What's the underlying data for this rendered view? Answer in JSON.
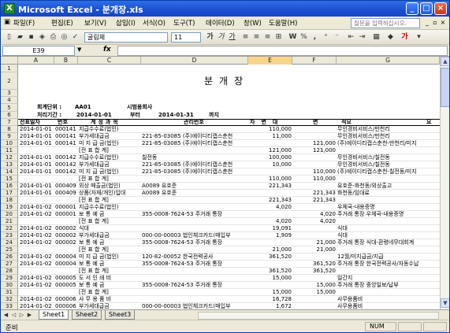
{
  "window": {
    "title": "Microsoft Excel - 분개장.xls",
    "min": "_",
    "max": "□",
    "close": "×"
  },
  "menu": {
    "items": [
      "파일(F)",
      "편집(E)",
      "보기(V)",
      "삽입(I)",
      "서식(O)",
      "도구(T)",
      "데이터(D)",
      "창(W)",
      "도움말(H)"
    ],
    "ask_placeholder": "질문을 입력하십시오."
  },
  "toolbar": {
    "font_name": "굴림체",
    "font_size": "11",
    "bold": "가",
    "italic": "가",
    "underline": "가",
    "percent": "%",
    "comma": ",",
    "won": "W",
    "font_color_letter": "가"
  },
  "formula": {
    "cell_ref": "E39",
    "fx": "fx",
    "value": ""
  },
  "columns": [
    "A",
    "B",
    "C",
    "D",
    "E",
    "F",
    "G"
  ],
  "header_rows": {
    "r1": "1",
    "r2": "2",
    "r3": "3",
    "r4": "4",
    "r5": "5",
    "r6": "6",
    "r7": "7",
    "title": "분개장",
    "unit_label": "회계단위 :",
    "unit_code": "AA01",
    "unit_name": "시범용회사",
    "period_label": "처리기간 :",
    "period_from": "2014-01-01",
    "period_to_label": "부터",
    "period_to": "2014-01-31",
    "period_end_label": "까지"
  },
  "table_header": {
    "date": "전표일자",
    "no": "번호",
    "account": "계정과목",
    "mgmt": "관리번호",
    "debit": "차변대",
    "credit": "변",
    "memo": "적요",
    "memo_end": "요"
  },
  "rows": [
    {
      "n": "8",
      "a": "2014-01-01",
      "b": "000141",
      "c": "지급수수료(법인)",
      "d": "",
      "e": "110,000",
      "f": "",
      "g": "무인경비서비스/만천리"
    },
    {
      "n": "9",
      "a": "2014-01-01",
      "b": "000141",
      "c": "부가세대급금",
      "d": "221-85-03085  (주)에이디티캡스춘천",
      "e": "11,000",
      "f": "",
      "g": "무인경비서비스/만천리"
    },
    {
      "n": "10",
      "a": "2014-01-01",
      "b": "000141",
      "c": "미 지 급 금(법인)",
      "d": "221-85-03085  (주)에이디티캡스춘천",
      "e": "",
      "f": "121,000",
      "g": "(주)에이디티캡스춘천-만천리/미지"
    },
    {
      "n": "11",
      "a": "",
      "b": "",
      "c": "[전 표 합 계]",
      "d": "",
      "e": "121,000",
      "f": "121,000",
      "g": ""
    },
    {
      "n": "12",
      "a": "2014-01-01",
      "b": "000142",
      "c": "지급수수료(법인)",
      "d": "칠전동",
      "e": "100,000",
      "f": "",
      "g": "무인경비서비스/칠전동"
    },
    {
      "n": "13",
      "a": "2014-01-01",
      "b": "000142",
      "c": "부가세대급금",
      "d": "221-85-03085  (주)에이디티캡스춘천",
      "e": "10,000",
      "f": "",
      "g": "무인경비서비스/칠전동"
    },
    {
      "n": "14",
      "a": "2014-01-01",
      "b": "000142",
      "c": "미 지 급 금(법인)",
      "d": "221-85-03085  (주)에이디티캡스춘천",
      "e": "",
      "f": "110,000",
      "g": "(주)에이디티캡스춘천-칠전동/미지"
    },
    {
      "n": "15",
      "a": "",
      "b": "",
      "c": "[전 표 합 계]",
      "d": "",
      "e": "110,000",
      "f": "110,000",
      "g": ""
    },
    {
      "n": "16",
      "a": "2014-01-01",
      "b": "000409",
      "c": "외상 매출금(법인)",
      "d": "A0089  유호준",
      "e": "221,343",
      "f": "",
      "g": "유호준-화천동/외상출고"
    },
    {
      "n": "17",
      "a": "2014-01-01",
      "b": "000409",
      "c": "상품(자재/개인)입대",
      "d": "A0089  유호준",
      "e": "",
      "f": "221,343",
      "g": "화천동/임대료"
    },
    {
      "n": "18",
      "a": "",
      "b": "",
      "c": "[전 표 합 계]",
      "d": "",
      "e": "221,343",
      "f": "221,343",
      "g": ""
    },
    {
      "n": "19",
      "a": "2014-01-02",
      "b": "000001",
      "c": "지급수수료(법인)",
      "d": "",
      "e": "4,020",
      "f": "",
      "g": "우체국-내용증명"
    },
    {
      "n": "20",
      "a": "2014-01-02",
      "b": "000001",
      "c": "보    통    예    금",
      "d": "355-0008-7624-53  주거래 통장",
      "e": "",
      "f": "4,020",
      "g": "주거래 통장 우체국-내용증명"
    },
    {
      "n": "21",
      "a": "",
      "b": "",
      "c": "[전 표 합 계]",
      "d": "",
      "e": "4,020",
      "f": "4,020",
      "g": ""
    },
    {
      "n": "22",
      "a": "2014-01-02",
      "b": "000002",
      "c": "식대",
      "d": "",
      "e": "19,091",
      "f": "",
      "g": "식대"
    },
    {
      "n": "23",
      "a": "2014-01-02",
      "b": "000002",
      "c": "부가세대급금",
      "d": "000-00-00003  법인체크카드(매입부",
      "e": "1,909",
      "f": "",
      "g": "식대"
    },
    {
      "n": "24",
      "a": "2014-01-02",
      "b": "000002",
      "c": "보    통    예    금",
      "d": "355-0008-7624-53  주거래 통장",
      "e": "",
      "f": "21,000",
      "g": "주거래 통장 식대-환령네무대회계"
    },
    {
      "n": "25",
      "a": "",
      "b": "",
      "c": "[전 표 합 계]",
      "d": "",
      "e": "21,000",
      "f": "21,000",
      "g": ""
    },
    {
      "n": "26",
      "a": "2014-01-02",
      "b": "000004",
      "c": "미 지 급 금(법인)",
      "d": "120-82-00052  한국전력공사",
      "e": "361,520",
      "f": "",
      "g": "12월/미지급금/지급"
    },
    {
      "n": "27",
      "a": "2014-01-02",
      "b": "000004",
      "c": "보    통    예    금",
      "d": "355-0008-7624-53  주거래 통장",
      "e": "",
      "f": "361,520",
      "g": "주거래 통장 한국전력공사/자동수납"
    },
    {
      "n": "28",
      "a": "",
      "b": "",
      "c": "[전 표 합 계]",
      "d": "",
      "e": "361,520",
      "f": "361,520",
      "g": ""
    },
    {
      "n": "29",
      "a": "2014-01-02",
      "b": "000005",
      "c": "도  서  인  쇄  비",
      "d": "",
      "e": "15,000",
      "f": "",
      "g": "일간지"
    },
    {
      "n": "30",
      "a": "2014-01-02",
      "b": "000005",
      "c": "보    통    예    금",
      "d": "355-0008-7624-53  주거래 통장",
      "e": "",
      "f": "15,000",
      "g": "주거래 통장 중앙일보/납부"
    },
    {
      "n": "31",
      "a": "",
      "b": "",
      "c": "[전 표 합 계]",
      "d": "",
      "e": "15,000",
      "f": "15,000",
      "g": ""
    },
    {
      "n": "32",
      "a": "2014-01-02",
      "b": "000006",
      "c": "사  무  용  품  비",
      "d": "",
      "e": "16,728",
      "f": "",
      "g": "사무용품비"
    },
    {
      "n": "33",
      "a": "2014-01-02",
      "b": "000006",
      "c": "부가세대급금",
      "d": "000-00-00003  법인체크카드(매입부",
      "e": "1,672",
      "f": "",
      "g": "사무용품비"
    }
  ],
  "sheets": [
    "Sheet1",
    "Sheet2",
    "Sheet3"
  ],
  "status": {
    "ready": "준비",
    "num": "NUM"
  }
}
